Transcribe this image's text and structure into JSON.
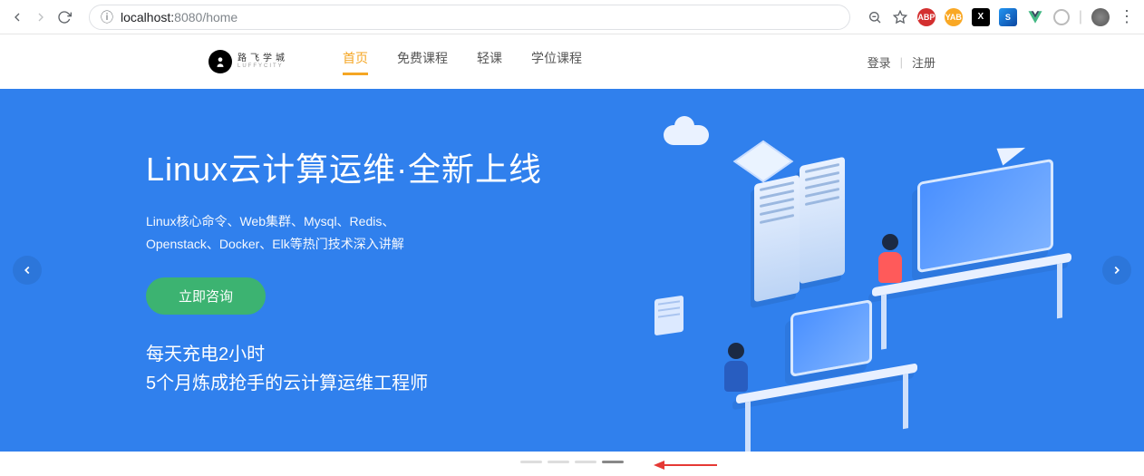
{
  "browser": {
    "url_protocol": "",
    "url_host": "localhost:",
    "url_port": "8080",
    "url_path": "/home",
    "info_prefix": "ⓘ",
    "extensions": [
      "ABP",
      "YAB",
      "X",
      "S",
      "V",
      "O"
    ]
  },
  "header": {
    "logo_main": "路飞学城",
    "logo_sub": "LUFFYCITY",
    "nav": [
      "首页",
      "免费课程",
      "轻课",
      "学位课程"
    ],
    "active_index": 0,
    "login": "登录",
    "register": "注册",
    "divider": "|"
  },
  "hero": {
    "title": "Linux云计算运维·全新上线",
    "sub_line1": "Linux核心命令、Web集群、Mysql、Redis、",
    "sub_line2": "Openstack、Docker、Elk等热门技术深入讲解",
    "cta": "立即咨询",
    "slogan_line1": "每天充电2小时",
    "slogan_line2": "5个月炼成抢手的云计算运维工程师"
  },
  "carousel": {
    "count": 4,
    "active_index": 3
  }
}
